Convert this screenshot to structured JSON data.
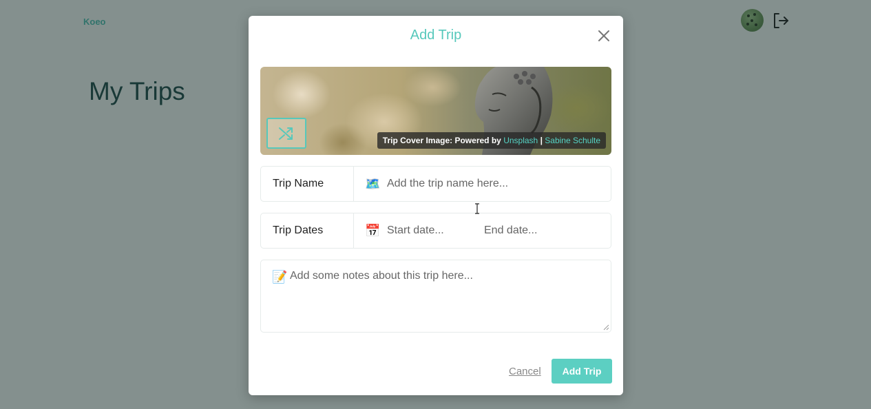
{
  "app": {
    "logo": "Koeo",
    "page_title": "My Trips"
  },
  "modal": {
    "title": "Add Trip",
    "cover": {
      "credit_prefix": "Trip Cover Image: Powered by",
      "credit_source": "Unsplash",
      "credit_separator": "|",
      "credit_author": "Sabine Schulte"
    },
    "trip_name": {
      "label": "Trip Name",
      "emoji": "🗺️",
      "placeholder": "Add the trip name here..."
    },
    "trip_dates": {
      "label": "Trip Dates",
      "emoji": "📅",
      "start_placeholder": "Start date...",
      "end_placeholder": "End date..."
    },
    "notes": {
      "emoji": "📝",
      "placeholder": "Add some notes about this trip here..."
    },
    "cancel_label": "Cancel",
    "submit_label": "Add Trip"
  },
  "colors": {
    "accent": "#5ccfc2",
    "title_text": "#1f4a48",
    "overlay": "rgba(20,40,38,0.5)"
  },
  "icons": [
    "shuffle-icon",
    "close-icon",
    "logout-icon",
    "map-emoji-icon",
    "calendar-emoji-icon",
    "memo-emoji-icon"
  ]
}
